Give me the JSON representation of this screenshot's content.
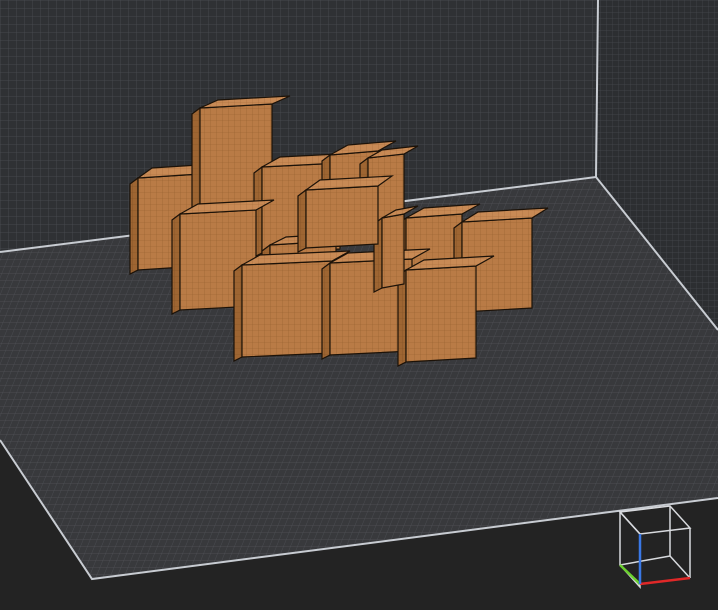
{
  "viewport": {
    "background_color": "#232323",
    "wall_color": "#2f3134",
    "floor_color": "#3a3b3e",
    "grid_color": "#55585d",
    "edge_color": "#c8ccd2"
  },
  "blocks": {
    "count": 14,
    "colors": {
      "top": "#c88a55",
      "front": "#b97b46",
      "side": "#9e6532",
      "outline": "#1c1208"
    }
  },
  "orientation_gizmo": {
    "icon": "view-cube-icon",
    "axis_colors": {
      "x": "#e02828",
      "y": "#6ad02c",
      "z": "#3a78e6"
    }
  }
}
